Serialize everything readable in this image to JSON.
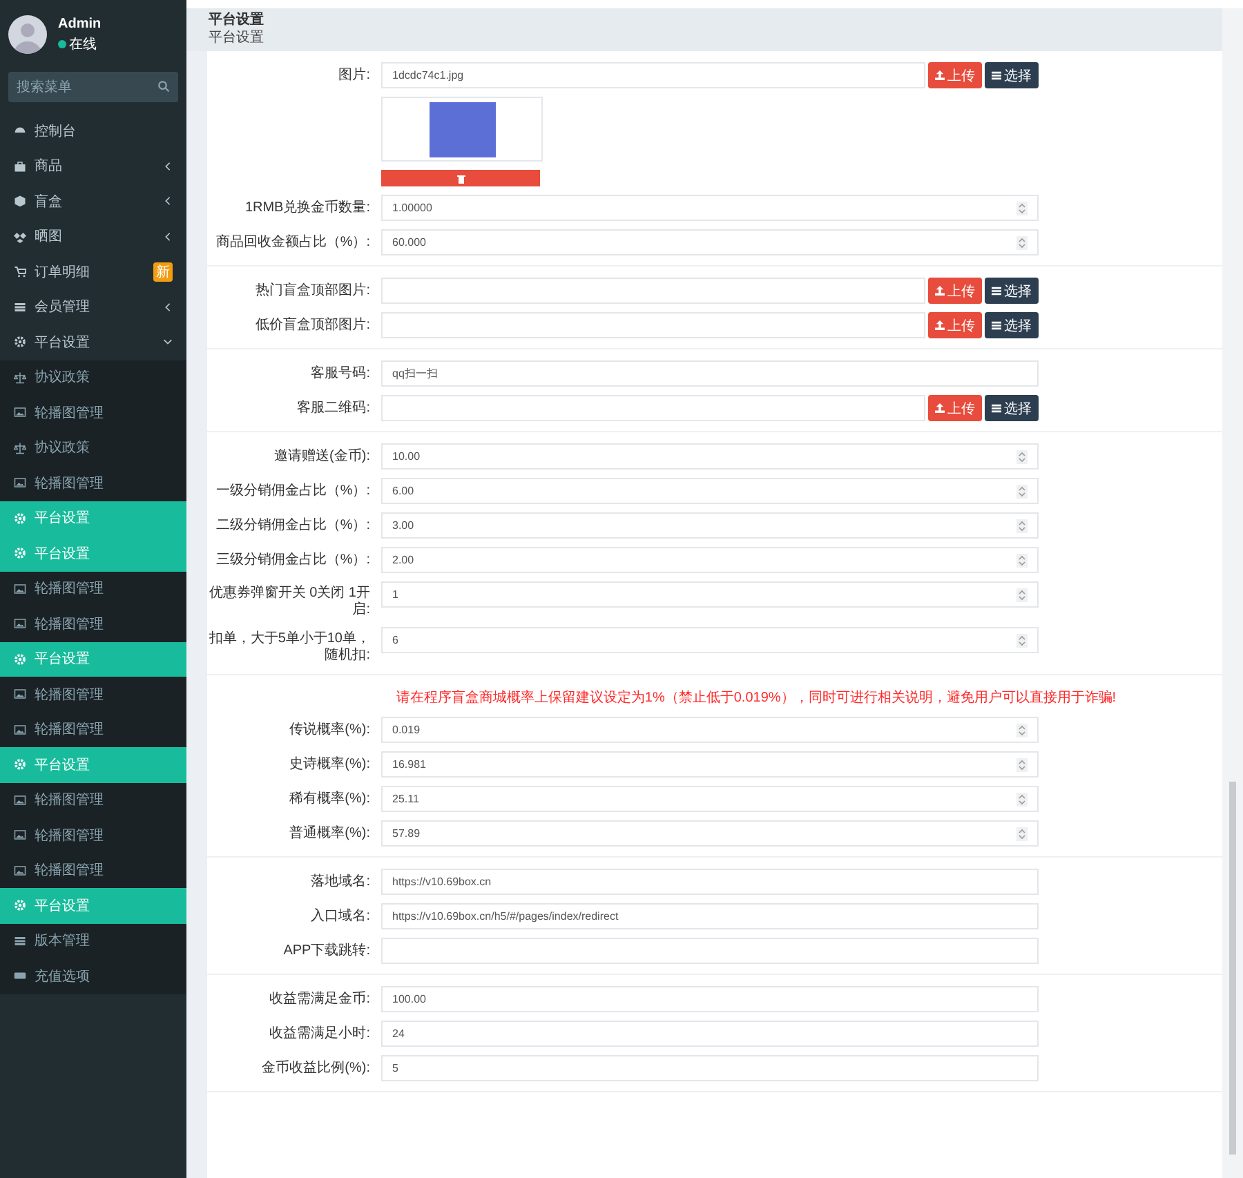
{
  "sidebar": {
    "user": {
      "name": "Admin",
      "status": "在线"
    },
    "search": {
      "placeholder": "搜索菜单"
    },
    "items": [
      {
        "label": "控制台",
        "kind": "menu",
        "selected": false
      },
      {
        "label": "商品",
        "kind": "menu",
        "selected": false,
        "expanded": false
      },
      {
        "label": "盲盒",
        "kind": "menu",
        "selected": false,
        "expanded": false
      },
      {
        "label": "晒图",
        "kind": "menu",
        "selected": false,
        "expanded": false
      },
      {
        "label": "订单明细",
        "kind": "menu",
        "selected": false,
        "badge": "新"
      },
      {
        "label": "会员管理",
        "kind": "menu",
        "selected": false,
        "expanded": false
      },
      {
        "label": "平台设置",
        "kind": "menu",
        "selected": false,
        "expanded": true
      },
      {
        "label": "协议政策",
        "kind": "sub",
        "selected": false
      },
      {
        "label": "轮播图管理",
        "kind": "sub",
        "selected": false
      },
      {
        "label": "协议政策",
        "kind": "sub",
        "selected": false
      },
      {
        "label": "轮播图管理",
        "kind": "sub",
        "selected": false
      },
      {
        "label": "平台设置",
        "kind": "sub",
        "selected": true
      },
      {
        "label": "平台设置",
        "kind": "sub",
        "selected": true
      },
      {
        "label": "轮播图管理",
        "kind": "sub",
        "selected": false
      },
      {
        "label": "轮播图管理",
        "kind": "sub",
        "selected": false
      },
      {
        "label": "平台设置",
        "kind": "sub",
        "selected": true
      },
      {
        "label": "轮播图管理",
        "kind": "sub",
        "selected": false
      },
      {
        "label": "轮播图管理",
        "kind": "sub",
        "selected": false
      },
      {
        "label": "平台设置",
        "kind": "sub",
        "selected": true
      },
      {
        "label": "轮播图管理",
        "kind": "sub",
        "selected": false
      },
      {
        "label": "轮播图管理",
        "kind": "sub",
        "selected": false
      },
      {
        "label": "轮播图管理",
        "kind": "sub",
        "selected": false
      },
      {
        "label": "平台设置",
        "kind": "sub",
        "selected": true
      },
      {
        "label": "版本管理",
        "kind": "sub",
        "selected": false
      },
      {
        "label": "充值选项",
        "kind": "sub",
        "selected": false
      }
    ]
  },
  "header": {
    "title": "平台设置",
    "subtitle": "平台设置"
  },
  "groups": [
    {
      "rows": [
        {
          "label": "图片:",
          "kind": "image",
          "value": "1dcdc74c1.jpg",
          "buttons": [
            "上传",
            "选择"
          ]
        },
        {
          "label": "1RMB兑换金币数量:",
          "kind": "number",
          "value": "1.00000"
        },
        {
          "label": "商品回收金额占比（%）:",
          "kind": "number",
          "value": "60.000"
        }
      ]
    },
    {
      "rows": [
        {
          "label": "热门盲盒顶部图片:",
          "kind": "upload",
          "buttons": [
            "上传",
            "选择"
          ]
        },
        {
          "label": "低价盲盒顶部图片:",
          "kind": "upload",
          "buttons": [
            "上传",
            "选择"
          ]
        }
      ]
    },
    {
      "rows": [
        {
          "label": "客服号码:",
          "kind": "text",
          "value": "qq扫一扫"
        },
        {
          "label": "客服二维码:",
          "kind": "upload",
          "buttons": [
            "上传",
            "选择"
          ]
        }
      ]
    },
    {
      "rows": [
        {
          "label": "邀请赠送(金币):",
          "kind": "number",
          "value": "10.00"
        },
        {
          "label": "一级分销佣金占比（%）:",
          "kind": "number",
          "value": "6.00"
        },
        {
          "label": "二级分销佣金占比（%）:",
          "kind": "number",
          "value": "3.00"
        },
        {
          "label": "三级分销佣金占比（%）:",
          "kind": "number",
          "value": "2.00"
        },
        {
          "label": "优惠券弹窗开关 0关闭 1开启:",
          "kind": "number",
          "value": "1"
        },
        {
          "label": "扣单，大于5单小于10单，随机扣:",
          "kind": "number",
          "value": "6"
        }
      ]
    },
    {
      "notice": "请在程序盲盒商城概率上保留建议设定为1%（禁止低于0.019%），同时可进行相关说明，避免用户可以直接用于诈骗!",
      "rows": [
        {
          "label": "传说概率(%):",
          "kind": "number",
          "value": "0.019"
        },
        {
          "label": "史诗概率(%):",
          "kind": "number",
          "value": "16.981"
        },
        {
          "label": "稀有概率(%):",
          "kind": "number",
          "value": "25.11"
        },
        {
          "label": "普通概率(%):",
          "kind": "number",
          "value": "57.89"
        }
      ]
    },
    {
      "rows": [
        {
          "label": "落地域名:",
          "kind": "text",
          "value": "https://v10.69box.cn"
        },
        {
          "label": "入口域名:",
          "kind": "text",
          "value": "https://v10.69box.cn/h5/#/pages/index/redirect"
        },
        {
          "label": "APP下载跳转:",
          "kind": "text"
        }
      ]
    },
    {
      "rows": [
        {
          "label": "收益需满足金币:",
          "kind": "text",
          "value": "100.00"
        },
        {
          "label": "收益需满足小时:",
          "kind": "text",
          "value": "24"
        },
        {
          "label": "金币收益比例(%):",
          "kind": "text",
          "value": "5"
        }
      ]
    }
  ]
}
